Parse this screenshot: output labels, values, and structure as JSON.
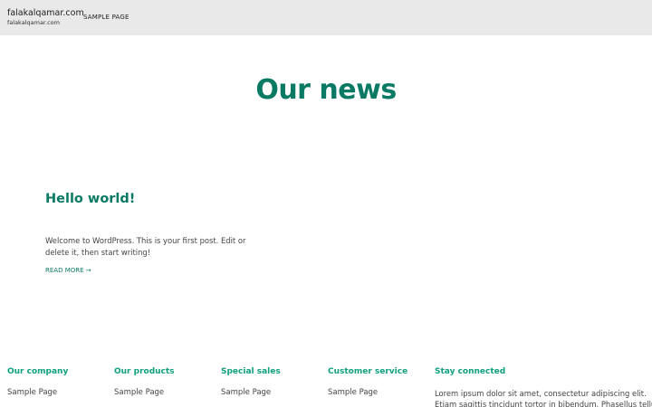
{
  "header": {
    "site_title": "falakalqamar.com",
    "site_tagline": "falakalqamar.com",
    "nav": [
      "SAMPLE PAGE"
    ]
  },
  "main": {
    "page_title": "Our news",
    "post": {
      "title": "Hello world!",
      "excerpt": "Welcome to WordPress. This is your first post. Edit or delete it, then start writing!",
      "read_more": "READ MORE →"
    }
  },
  "footer": {
    "columns": [
      {
        "heading": "Our company",
        "link": "Sample Page"
      },
      {
        "heading": "Our products",
        "link": "Sample Page"
      },
      {
        "heading": "Special sales",
        "link": "Sample Page"
      },
      {
        "heading": "Customer service",
        "link": "Sample Page"
      }
    ],
    "stay_connected": {
      "heading": "Stay connected",
      "text_line1": "Lorem ipsum dolor sit amet, consectetur adipiscing elit.",
      "text_line2": "Etiam sagittis tincidunt tortor in bibendum. Phasellus tellus"
    }
  },
  "colors": {
    "accent": "#0b7a64",
    "footer_heading": "#0fa07f",
    "header_bg": "#e9e9e9"
  }
}
